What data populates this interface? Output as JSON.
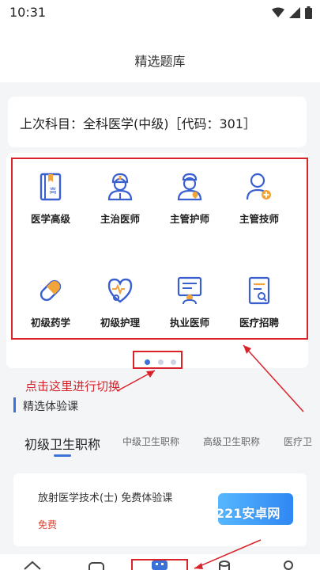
{
  "status_bar": {
    "time": "10:31",
    "icons": [
      "wifi-icon",
      "signal-icon",
      "battery-icon"
    ]
  },
  "header": {
    "title": "精选题库"
  },
  "last_subject": {
    "text": "上次科目：全科医学(中级)［代码：301］"
  },
  "categories": [
    {
      "label": "医学高级",
      "icon": "book-icon"
    },
    {
      "label": "主治医师",
      "icon": "doctor-icon"
    },
    {
      "label": "主管护师",
      "icon": "nurse-icon"
    },
    {
      "label": "主管技师",
      "icon": "technician-icon"
    },
    {
      "label": "初级药学",
      "icon": "capsule-icon"
    },
    {
      "label": "初级护理",
      "icon": "heart-stethoscope-icon"
    },
    {
      "label": "执业医师",
      "icon": "medical-board-icon"
    },
    {
      "label": "医疗招聘",
      "icon": "document-search-icon"
    }
  ],
  "pager": {
    "total": 3,
    "active": 1
  },
  "annotation": {
    "text": "点击这里进行切换"
  },
  "section": {
    "title": "精选体验课"
  },
  "tabs": [
    {
      "label": "初级卫生职称",
      "active": true
    },
    {
      "label": "中级卫生职称",
      "active": false
    },
    {
      "label": "高级卫生职称",
      "active": false
    },
    {
      "label": "医疗卫",
      "active": false
    }
  ],
  "course": {
    "title": "放射医学技术(士) 免费体验课",
    "price": "免费",
    "watermark": "221安卓网"
  },
  "bottom_nav": [
    "home-icon",
    "square-icon",
    "question-bank-icon",
    "cylinder-icon",
    "profile-icon"
  ],
  "colors": {
    "accent": "#3a72d8",
    "annotation_red": "#d9232a",
    "icon_blue": "#3a5fcf",
    "price_red": "#e0402f"
  }
}
